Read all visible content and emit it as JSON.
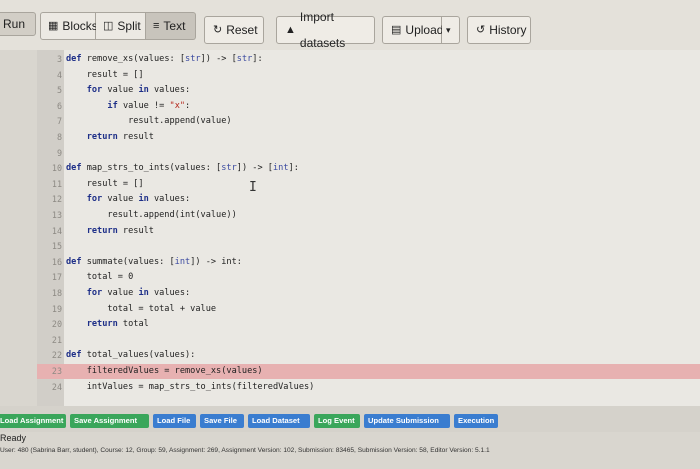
{
  "toolbar": {
    "run": "Run",
    "blocks": "Blocks",
    "split": "Split",
    "text": "Text",
    "reset": "Reset",
    "import": "Import datasets",
    "upload": "Upload",
    "history": "History",
    "icons": {
      "blocks": "grid-icon",
      "split": "split-icon",
      "text": "text-lines-icon",
      "reset": "refresh-icon",
      "import": "drive-icon",
      "upload": "document-icon",
      "caret": "caret-down-icon",
      "history": "history-icon"
    }
  },
  "editor": {
    "lines": [
      {
        "n": "3",
        "code": "def remove_xs(values: [str]) -> [str]:"
      },
      {
        "n": "4",
        "code": "    result = []"
      },
      {
        "n": "5",
        "code": "    for value in values:"
      },
      {
        "n": "6",
        "code": "        if value != \"x\":"
      },
      {
        "n": "7",
        "code": "            result.append(value)"
      },
      {
        "n": "8",
        "code": "    return result"
      },
      {
        "n": "9",
        "code": ""
      },
      {
        "n": "10",
        "code": "def map_strs_to_ints(values: [str]) -> [int]:"
      },
      {
        "n": "11",
        "code": "    result = []"
      },
      {
        "n": "12",
        "code": "    for value in values:"
      },
      {
        "n": "13",
        "code": "        result.append(int(value))"
      },
      {
        "n": "14",
        "code": "    return result"
      },
      {
        "n": "15",
        "code": ""
      },
      {
        "n": "16",
        "code": "def summate(values: [int]) -> int:"
      },
      {
        "n": "17",
        "code": "    total = 0"
      },
      {
        "n": "18",
        "code": "    for value in values:"
      },
      {
        "n": "19",
        "code": "        total = total + value"
      },
      {
        "n": "20",
        "code": "    return total"
      },
      {
        "n": "21",
        "code": ""
      },
      {
        "n": "22",
        "code": "def total_values(values):"
      },
      {
        "n": "23",
        "code": "    filteredValues = remove_xs(values)",
        "error": true
      },
      {
        "n": "24",
        "code": "    intValues = map_strs_to_ints(filteredValues)"
      }
    ]
  },
  "actions": [
    {
      "label": "Load Assignment",
      "color": "green"
    },
    {
      "label": "Save Assignment",
      "color": "green"
    },
    {
      "label": "Load File",
      "color": "blue"
    },
    {
      "label": "Save File",
      "color": "blue"
    },
    {
      "label": "Load Dataset",
      "color": "blue"
    },
    {
      "label": "Log Event",
      "color": "green"
    },
    {
      "label": "Update Submission",
      "color": "blue"
    },
    {
      "label": "Execution",
      "color": "blue"
    }
  ],
  "status": {
    "state": "Ready",
    "info": "User: 480 (Sabrina Barr, student), Course: 12, Group: 59, Assignment: 269, Assignment Version: 102, Submission: 83465, Submission Version: 58, Editor Version: 5.1.1"
  }
}
